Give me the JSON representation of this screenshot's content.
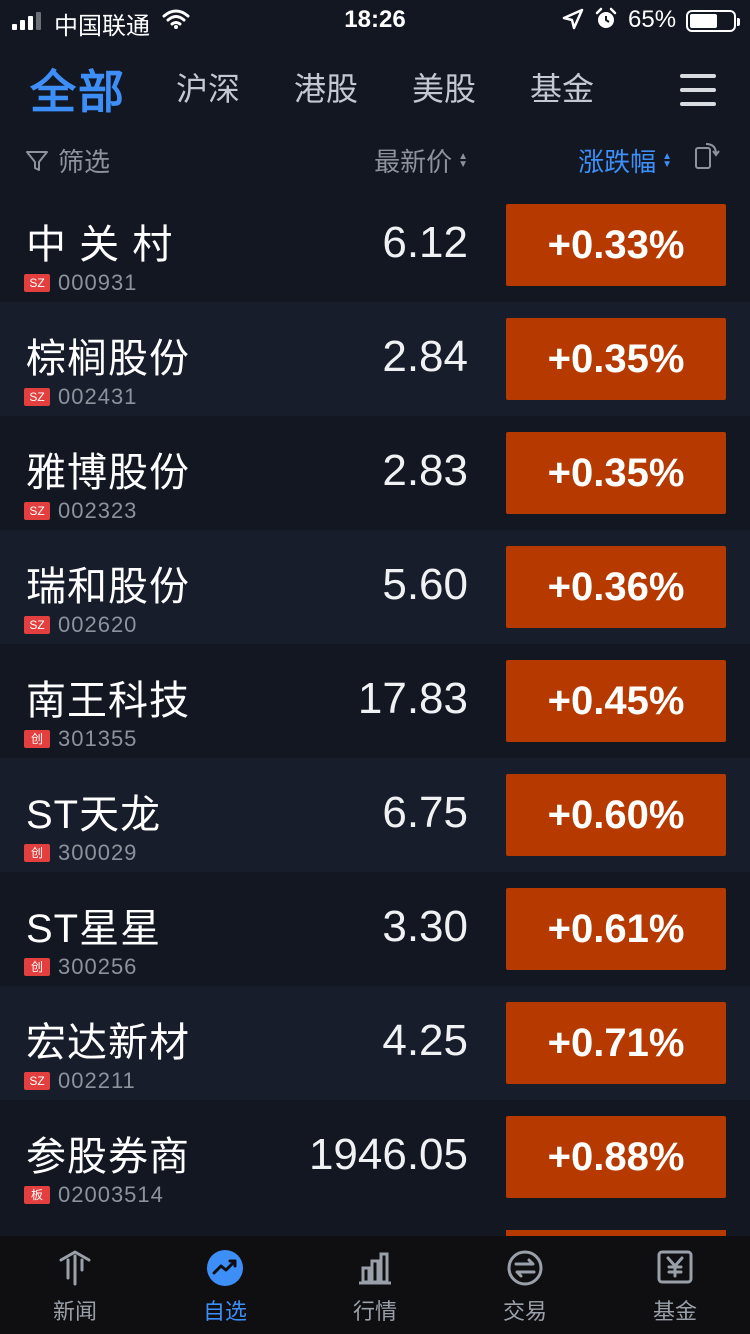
{
  "status_bar": {
    "carrier": "中国联通",
    "time": "18:26",
    "battery": "65%",
    "battery_level": 0.65,
    "icons": [
      "signal-icon",
      "wifi-icon",
      "location-arrow-icon",
      "alarm-icon",
      "battery-icon"
    ]
  },
  "tabs": [
    {
      "label": "全部",
      "active": true
    },
    {
      "label": "沪深",
      "active": false
    },
    {
      "label": "港股",
      "active": false
    },
    {
      "label": "美股",
      "active": false
    },
    {
      "label": "基金",
      "active": false
    }
  ],
  "header": {
    "filter": "筛选",
    "price_col": "最新价",
    "change_col": "涨跌幅"
  },
  "stocks": [
    {
      "name": "中 关 村",
      "badge": "SZ",
      "code": "000931",
      "price": "6.12",
      "change": "+0.33%"
    },
    {
      "name": "棕榈股份",
      "badge": "SZ",
      "code": "002431",
      "price": "2.84",
      "change": "+0.35%"
    },
    {
      "name": "雅博股份",
      "badge": "SZ",
      "code": "002323",
      "price": "2.83",
      "change": "+0.35%"
    },
    {
      "name": "瑞和股份",
      "badge": "SZ",
      "code": "002620",
      "price": "5.60",
      "change": "+0.36%"
    },
    {
      "name": "南王科技",
      "badge": "创",
      "code": "301355",
      "price": "17.83",
      "change": "+0.45%"
    },
    {
      "name": "ST天龙",
      "badge": "创",
      "code": "300029",
      "price": "6.75",
      "change": "+0.60%"
    },
    {
      "name": "ST星星",
      "badge": "创",
      "code": "300256",
      "price": "3.30",
      "change": "+0.61%"
    },
    {
      "name": "宏达新材",
      "badge": "SZ",
      "code": "002211",
      "price": "4.25",
      "change": "+0.71%"
    },
    {
      "name": "参股券商",
      "badge": "板",
      "code": "02003514",
      "price": "1946.05",
      "change": "+0.88%"
    }
  ],
  "nav": [
    {
      "label": "新闻",
      "icon": "news-icon",
      "active": false
    },
    {
      "label": "自选",
      "icon": "watchlist-trend-icon",
      "active": true
    },
    {
      "label": "行情",
      "icon": "bar-chart-icon",
      "active": false
    },
    {
      "label": "交易",
      "icon": "exchange-icon",
      "active": false
    },
    {
      "label": "基金",
      "icon": "fund-yen-icon",
      "active": false
    }
  ],
  "colors": {
    "background": "#121722",
    "row_alt": "#171d2a",
    "accent_blue": "#3e8ef7",
    "change_box": "#b63a00",
    "badge_red": "#e33f3f",
    "muted_text": "#8d929c"
  }
}
